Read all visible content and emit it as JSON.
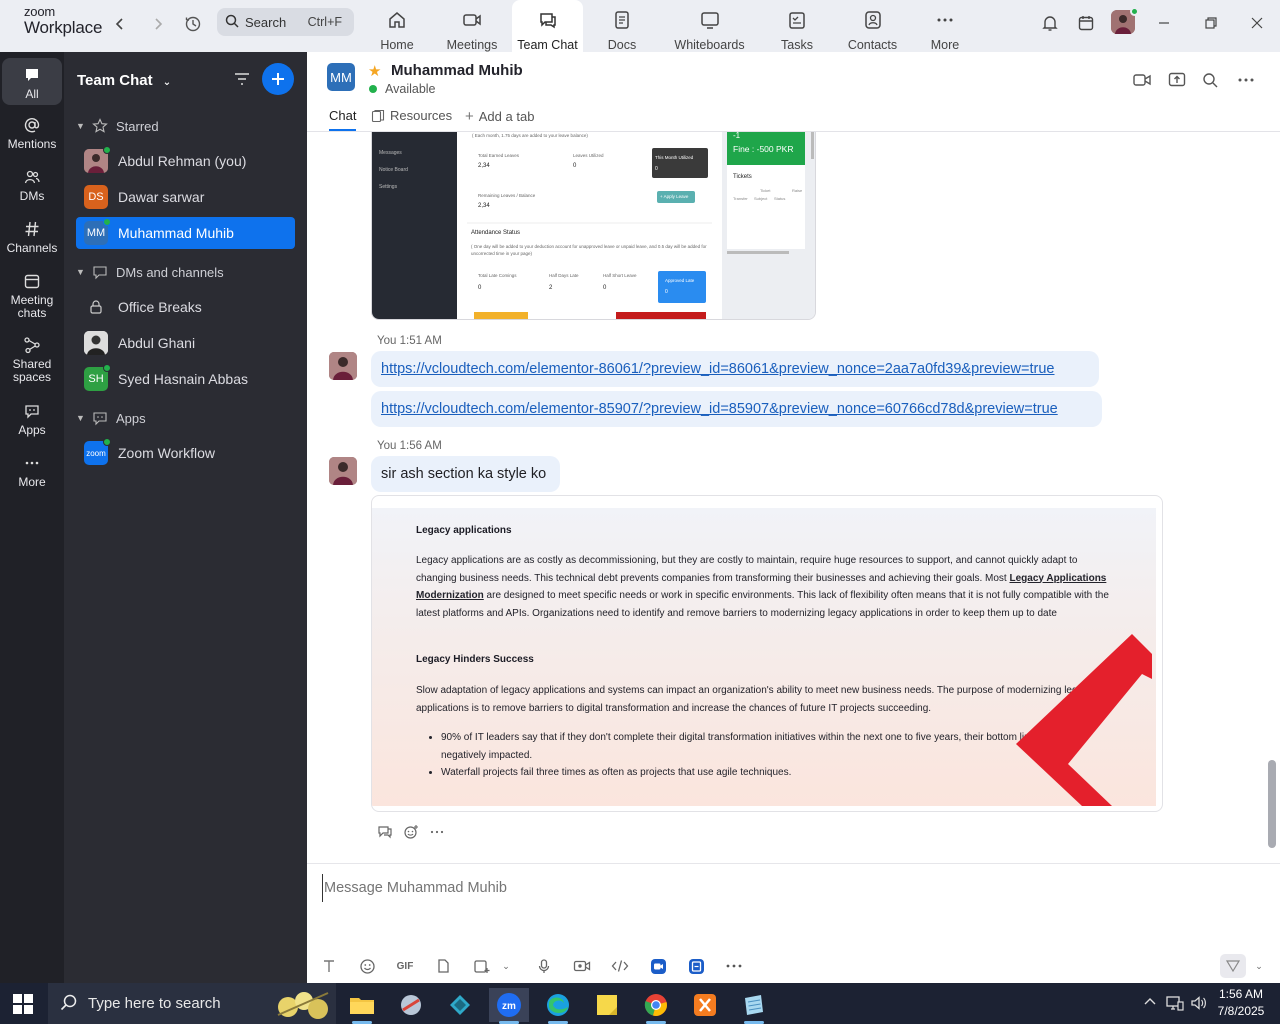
{
  "app": {
    "brand_line1": "zoom",
    "brand_line2": "Workplace"
  },
  "top_search": {
    "placeholder": "Search",
    "shortcut": "Ctrl+F"
  },
  "top_tabs": [
    {
      "label": "Home",
      "icon": "home-icon"
    },
    {
      "label": "Meetings",
      "icon": "video-icon"
    },
    {
      "label": "Team Chat",
      "icon": "chat-icon",
      "active": true
    },
    {
      "label": "Docs",
      "icon": "doc-icon"
    },
    {
      "label": "Whiteboards",
      "icon": "whiteboard-icon"
    },
    {
      "label": "Tasks",
      "icon": "tasks-icon"
    },
    {
      "label": "Contacts",
      "icon": "contacts-icon"
    },
    {
      "label": "More",
      "icon": "more-icon"
    }
  ],
  "rail": [
    {
      "label": "All",
      "icon": "chat-bubble-icon",
      "active": true
    },
    {
      "label": "Mentions",
      "icon": "at-icon"
    },
    {
      "label": "DMs",
      "icon": "people-icon"
    },
    {
      "label": "Channels",
      "icon": "hash-icon"
    },
    {
      "label": "Meeting chats",
      "icon": "calendar-icon"
    },
    {
      "label": "Shared spaces",
      "icon": "share-icon"
    },
    {
      "label": "Apps",
      "icon": "apps-icon"
    },
    {
      "label": "More",
      "icon": "more-icon"
    }
  ],
  "sidebar": {
    "title": "Team Chat",
    "sections": {
      "starred": "Starred",
      "dms": "DMs and channels",
      "apps": "Apps"
    },
    "starred_items": [
      {
        "label": "Abdul Rehman (you)",
        "initials": "",
        "color": "#8b5a5a",
        "online": true
      },
      {
        "label": "Dawar sarwar",
        "initials": "DS",
        "color": "#d8621d",
        "online": false
      },
      {
        "label": "Muhammad Muhib",
        "initials": "MM",
        "color": "#2d6fb8",
        "online": true,
        "selected": true
      }
    ],
    "dm_items": [
      {
        "label": "Office Breaks",
        "icon": "lock-icon"
      },
      {
        "label": "Abdul Ghani",
        "initials": "",
        "color": "#555555"
      },
      {
        "label": "Syed Hasnain Abbas",
        "initials": "SH",
        "color": "#2ea043",
        "online": true
      }
    ],
    "app_items": [
      {
        "label": "Zoom Workflow",
        "initials": "zoom",
        "color": "#0e72ed"
      }
    ]
  },
  "chat": {
    "avatar_initials": "MM",
    "name": "Muhammad Muhib",
    "status": "Available",
    "tabs": {
      "chat": "Chat",
      "resources": "Resources",
      "add": "Add a tab"
    }
  },
  "screenshot1": {
    "sidebar_items": [
      "Messages",
      "Notice Board",
      "Settings"
    ],
    "balance_note": "( Each month, 1.75 days are added to your leave balance)",
    "total_earned_label": "Total Earned Leaves",
    "total_earned_value": "2,34",
    "utilized_label": "Leaves Utilized",
    "utilized_value": "0",
    "month_utilized_label": "This Month Utilized",
    "month_utilized_value": "0",
    "remaining_label": "Remaining Leaves / Balance",
    "remaining_value": "2,34",
    "apply_label": "+ Apply Leave",
    "attendance_title": "Attendance Status",
    "attendance_note": "( One day will be added to your deduction account for unapproved leave or unpaid leave, and 0.5 day will be added for uncorrected time in your page)",
    "late_label": "Total Late Comings",
    "late_value": "0",
    "half_day_label": "Half Days Late",
    "half_day_value": "2",
    "half_short_label": "Half Short Leave",
    "half_short_value": "0",
    "approved_label": "Approved Late",
    "approved_value": "0",
    "fine": "Fine : -500 PKR",
    "fine_top": "-1",
    "tickets": "Tickets",
    "ticket_cols": [
      "Ticket",
      "Raise"
    ],
    "ticket_cols2": [
      "Transfer",
      "Subject",
      "Status"
    ]
  },
  "messages": [
    {
      "sender": "You",
      "time": "1:51 AM",
      "links": [
        "https://vcloudtech.com/elementor-86061/?preview_id=86061&preview_nonce=2aa7a0fd39&preview=true",
        "https://vcloudtech.com/elementor-85907/?preview_id=85907&preview_nonce=60766cd78d&preview=true"
      ]
    },
    {
      "sender": "You",
      "time": "1:56 AM",
      "text": "sir ash section ka style ko"
    }
  ],
  "screenshot2": {
    "h1": "Legacy applications",
    "p1a": "Legacy applications are as costly as decommissioning, but they are costly to maintain, require huge resources to support, and cannot quickly adapt to changing business needs. This technical debt prevents companies from transforming their businesses and achieving their goals. Most ",
    "p1link": "Legacy Applications Modernization",
    "p1b": " are designed to meet specific needs or work in specific environments. This lack of flexibility often means that it is not fully compatible with the latest platforms and APIs. Organizations need to identify and remove barriers to modernizing legacy applications in order to keep them up to date",
    "h2": "Legacy Hinders Success",
    "p2": "Slow adaptation of legacy applications and systems can impact an organization's ability to meet new business needs. The purpose of modernizing legacy applications is to remove barriers to digital transformation and increase the chances of future IT projects succeeding.",
    "bullets": [
      "90% of IT leaders say that if they don't complete their digital transformation initiatives within the next one to five years, their bottom line will be negatively impacted.",
      "Waterfall projects fail three times as often as projects that use agile techniques."
    ]
  },
  "composer": {
    "placeholder": "Message Muhammad Muhib",
    "gif": "GIF"
  },
  "taskbar": {
    "search_placeholder": "Type here to search",
    "time": "1:56 AM",
    "date": "7/8/2025"
  },
  "colors": {
    "accent": "#0e72ed",
    "sidebar_bg": "#2b2c33",
    "rail_bg": "#202127",
    "online": "#22b14c"
  }
}
